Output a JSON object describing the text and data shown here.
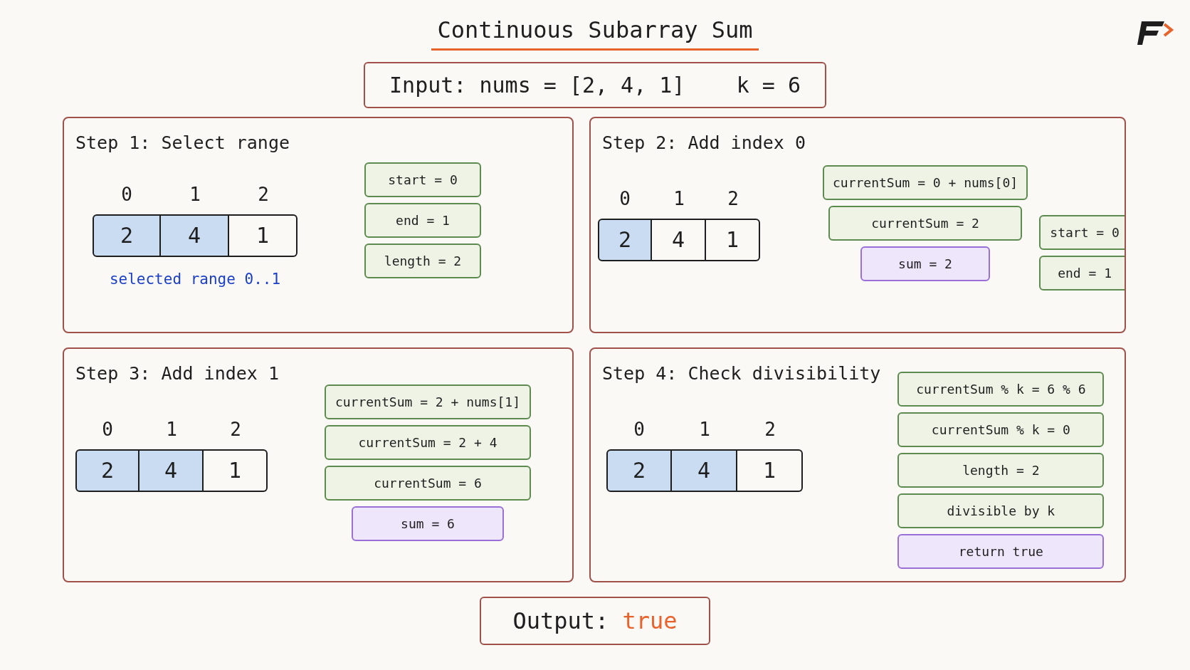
{
  "title": "Continuous Subarray Sum",
  "input": "Input: nums = [2, 4, 1]    k = 6",
  "steps": [
    {
      "title": "Step 1: Select range",
      "cells": [
        {
          "index": "0",
          "value": "2",
          "selected": true
        },
        {
          "index": "1",
          "value": "4",
          "selected": true
        },
        {
          "index": "2",
          "value": "1",
          "selected": false
        }
      ],
      "note": "selected range 0..1",
      "columns": [
        [
          {
            "kind": "state",
            "text": "start = 0"
          },
          {
            "kind": "state",
            "text": "end = 1"
          },
          {
            "kind": "state",
            "text": "length = 2"
          }
        ]
      ]
    },
    {
      "title": "Step 2: Add index 0",
      "cells": [
        {
          "index": "0",
          "value": "2",
          "selected": true
        },
        {
          "index": "1",
          "value": "4",
          "selected": false
        },
        {
          "index": "2",
          "value": "1",
          "selected": false
        }
      ],
      "columns": [
        [
          {
            "kind": "state",
            "text": "currentSum = 0 + nums[0]"
          },
          {
            "kind": "state",
            "text": "currentSum = 2"
          },
          {
            "kind": "result",
            "text": "sum = 2"
          }
        ],
        [
          {
            "kind": "state",
            "text": "start = 0"
          },
          {
            "kind": "state",
            "text": "end = 1"
          }
        ]
      ]
    },
    {
      "title": "Step 3: Add index 1",
      "cells": [
        {
          "index": "0",
          "value": "2",
          "selected": true
        },
        {
          "index": "1",
          "value": "4",
          "selected": true
        },
        {
          "index": "2",
          "value": "1",
          "selected": false
        }
      ],
      "columns": [
        [
          {
            "kind": "state",
            "text": "currentSum = 2 + nums[1]"
          },
          {
            "kind": "state",
            "text": "currentSum = 2 + 4"
          },
          {
            "kind": "state",
            "text": "currentSum = 6"
          },
          {
            "kind": "result",
            "text": "sum = 6"
          }
        ]
      ]
    },
    {
      "title": "Step 4: Check divisibility",
      "cells": [
        {
          "index": "0",
          "value": "2",
          "selected": true
        },
        {
          "index": "1",
          "value": "4",
          "selected": true
        },
        {
          "index": "2",
          "value": "1",
          "selected": false
        }
      ],
      "columns": [
        [
          {
            "kind": "state",
            "text": "currentSum % k = 6 % 6"
          },
          {
            "kind": "state",
            "text": "currentSum % k = 0"
          },
          {
            "kind": "state",
            "text": "length = 2"
          },
          {
            "kind": "state",
            "text": "divisible by k"
          },
          {
            "kind": "result",
            "text": "return true"
          }
        ]
      ]
    }
  ],
  "output": {
    "label": "Output:",
    "value": "true"
  }
}
